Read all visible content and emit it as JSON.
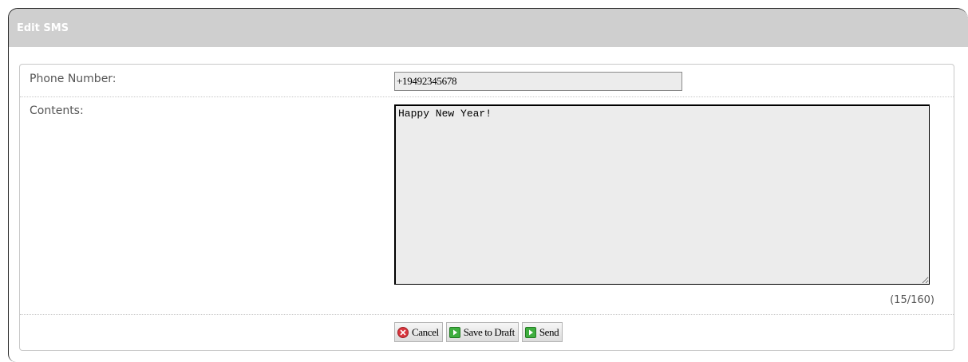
{
  "window": {
    "title": "Edit SMS"
  },
  "form": {
    "phone_label": "Phone Number:",
    "phone_value": "+19492345678",
    "contents_label": "Contents:",
    "contents_value": "Happy New Year!",
    "char_count": "(15/160)"
  },
  "buttons": {
    "cancel_label": "Cancel",
    "cancel_icon": "cancel-icon",
    "save_draft_label": "Save to Draft",
    "save_draft_icon": "play-icon",
    "send_label": "Send",
    "send_icon": "play-icon"
  },
  "colors": {
    "titlebar": "#cfcfcf",
    "cancel_icon": "#d9363e",
    "action_icon": "#3fae3f"
  }
}
